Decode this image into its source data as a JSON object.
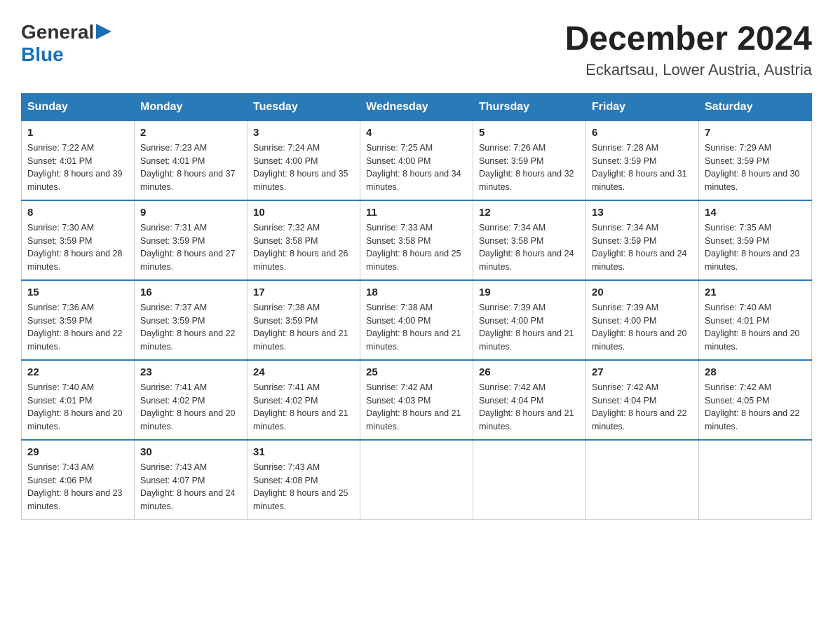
{
  "logo": {
    "general": "General",
    "blue": "Blue"
  },
  "title": "December 2024",
  "subtitle": "Eckartsau, Lower Austria, Austria",
  "days_of_week": [
    "Sunday",
    "Monday",
    "Tuesday",
    "Wednesday",
    "Thursday",
    "Friday",
    "Saturday"
  ],
  "weeks": [
    [
      {
        "day": "1",
        "sunrise": "7:22 AM",
        "sunset": "4:01 PM",
        "daylight": "8 hours and 39 minutes."
      },
      {
        "day": "2",
        "sunrise": "7:23 AM",
        "sunset": "4:01 PM",
        "daylight": "8 hours and 37 minutes."
      },
      {
        "day": "3",
        "sunrise": "7:24 AM",
        "sunset": "4:00 PM",
        "daylight": "8 hours and 35 minutes."
      },
      {
        "day": "4",
        "sunrise": "7:25 AM",
        "sunset": "4:00 PM",
        "daylight": "8 hours and 34 minutes."
      },
      {
        "day": "5",
        "sunrise": "7:26 AM",
        "sunset": "3:59 PM",
        "daylight": "8 hours and 32 minutes."
      },
      {
        "day": "6",
        "sunrise": "7:28 AM",
        "sunset": "3:59 PM",
        "daylight": "8 hours and 31 minutes."
      },
      {
        "day": "7",
        "sunrise": "7:29 AM",
        "sunset": "3:59 PM",
        "daylight": "8 hours and 30 minutes."
      }
    ],
    [
      {
        "day": "8",
        "sunrise": "7:30 AM",
        "sunset": "3:59 PM",
        "daylight": "8 hours and 28 minutes."
      },
      {
        "day": "9",
        "sunrise": "7:31 AM",
        "sunset": "3:59 PM",
        "daylight": "8 hours and 27 minutes."
      },
      {
        "day": "10",
        "sunrise": "7:32 AM",
        "sunset": "3:58 PM",
        "daylight": "8 hours and 26 minutes."
      },
      {
        "day": "11",
        "sunrise": "7:33 AM",
        "sunset": "3:58 PM",
        "daylight": "8 hours and 25 minutes."
      },
      {
        "day": "12",
        "sunrise": "7:34 AM",
        "sunset": "3:58 PM",
        "daylight": "8 hours and 24 minutes."
      },
      {
        "day": "13",
        "sunrise": "7:34 AM",
        "sunset": "3:59 PM",
        "daylight": "8 hours and 24 minutes."
      },
      {
        "day": "14",
        "sunrise": "7:35 AM",
        "sunset": "3:59 PM",
        "daylight": "8 hours and 23 minutes."
      }
    ],
    [
      {
        "day": "15",
        "sunrise": "7:36 AM",
        "sunset": "3:59 PM",
        "daylight": "8 hours and 22 minutes."
      },
      {
        "day": "16",
        "sunrise": "7:37 AM",
        "sunset": "3:59 PM",
        "daylight": "8 hours and 22 minutes."
      },
      {
        "day": "17",
        "sunrise": "7:38 AM",
        "sunset": "3:59 PM",
        "daylight": "8 hours and 21 minutes."
      },
      {
        "day": "18",
        "sunrise": "7:38 AM",
        "sunset": "4:00 PM",
        "daylight": "8 hours and 21 minutes."
      },
      {
        "day": "19",
        "sunrise": "7:39 AM",
        "sunset": "4:00 PM",
        "daylight": "8 hours and 21 minutes."
      },
      {
        "day": "20",
        "sunrise": "7:39 AM",
        "sunset": "4:00 PM",
        "daylight": "8 hours and 20 minutes."
      },
      {
        "day": "21",
        "sunrise": "7:40 AM",
        "sunset": "4:01 PM",
        "daylight": "8 hours and 20 minutes."
      }
    ],
    [
      {
        "day": "22",
        "sunrise": "7:40 AM",
        "sunset": "4:01 PM",
        "daylight": "8 hours and 20 minutes."
      },
      {
        "day": "23",
        "sunrise": "7:41 AM",
        "sunset": "4:02 PM",
        "daylight": "8 hours and 20 minutes."
      },
      {
        "day": "24",
        "sunrise": "7:41 AM",
        "sunset": "4:02 PM",
        "daylight": "8 hours and 21 minutes."
      },
      {
        "day": "25",
        "sunrise": "7:42 AM",
        "sunset": "4:03 PM",
        "daylight": "8 hours and 21 minutes."
      },
      {
        "day": "26",
        "sunrise": "7:42 AM",
        "sunset": "4:04 PM",
        "daylight": "8 hours and 21 minutes."
      },
      {
        "day": "27",
        "sunrise": "7:42 AM",
        "sunset": "4:04 PM",
        "daylight": "8 hours and 22 minutes."
      },
      {
        "day": "28",
        "sunrise": "7:42 AM",
        "sunset": "4:05 PM",
        "daylight": "8 hours and 22 minutes."
      }
    ],
    [
      {
        "day": "29",
        "sunrise": "7:43 AM",
        "sunset": "4:06 PM",
        "daylight": "8 hours and 23 minutes."
      },
      {
        "day": "30",
        "sunrise": "7:43 AM",
        "sunset": "4:07 PM",
        "daylight": "8 hours and 24 minutes."
      },
      {
        "day": "31",
        "sunrise": "7:43 AM",
        "sunset": "4:08 PM",
        "daylight": "8 hours and 25 minutes."
      },
      null,
      null,
      null,
      null
    ]
  ]
}
